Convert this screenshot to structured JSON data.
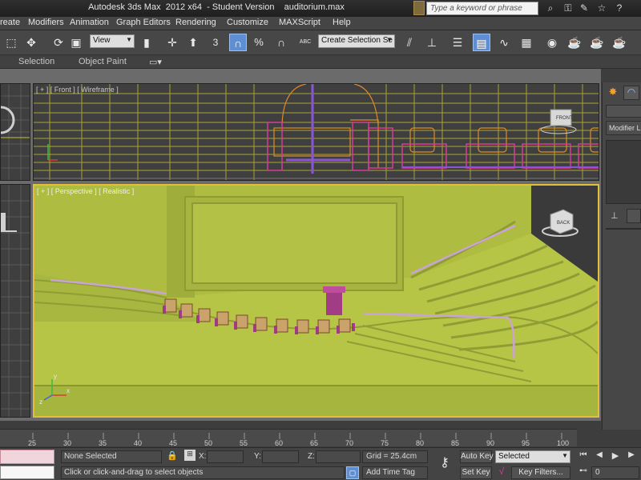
{
  "window": {
    "title": "Autodesk 3ds Max  2012 x64  - Student Version    auditorium.max",
    "search_placeholder": "Type a keyword or phrase"
  },
  "menu": [
    "reate",
    "Modifiers",
    "Animation",
    "Graph Editors",
    "Rendering",
    "Customize",
    "MAXScript",
    "Help"
  ],
  "toolbar": {
    "reference_coord": "View",
    "selection_set": "Create Selection Se",
    "snap_label": "3",
    "percent_label": "%",
    "abc_label": "ABC"
  },
  "ribbon": {
    "tabs": [
      "Selection",
      "Object Paint"
    ]
  },
  "viewports": {
    "front_label": "[ + ] [ Front ] [ Wireframe ]",
    "perspective_label": "[ + ] [ Perspective ] [ Realistic ]",
    "viewcube_front": "FRONT",
    "viewcube_back": "BACK",
    "gizmo_x": "x",
    "gizmo_y": "y",
    "gizmo_z": "z"
  },
  "command_panel": {
    "modifier_list": "Modifier Lis"
  },
  "timeline": {
    "ticks": [
      "25",
      "30",
      "35",
      "40",
      "45",
      "50",
      "55",
      "60",
      "65",
      "70",
      "75",
      "80",
      "85",
      "90",
      "95",
      "100"
    ]
  },
  "status": {
    "selection": "None Selected",
    "prompt": "Click or click-and-drag to select objects",
    "x_label": "X:",
    "y_label": "Y:",
    "z_label": "Z:",
    "grid": "Grid = 25.4cm",
    "add_time_tag": "Add Time Tag",
    "auto_key": "Auto Key",
    "set_key": "Set Key",
    "key_mode": "Selected",
    "key_filters": "Key Filters...",
    "frame": "0"
  },
  "colors": {
    "accent_blue": "#5e8fd4",
    "viewport_active_border": "#e2c13a",
    "scene_floor": "#b7c547",
    "wireframe_yellow": "#c7c13a",
    "wireframe_magenta": "#d83c9a",
    "wireframe_orange": "#e08a2a",
    "wireframe_purple": "#8a55d6"
  }
}
